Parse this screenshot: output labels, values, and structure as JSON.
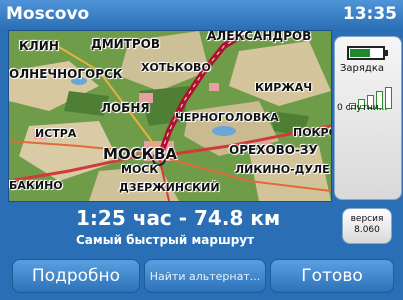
{
  "header": {
    "title": "Moscovo",
    "time": "13:35"
  },
  "map": {
    "cities": {
      "klin": "КЛИН",
      "dmitrov": "ДМИТРОВ",
      "aleksandrov": "АЛЕКСАНДРОВ",
      "hotkovo": "ХОТЬКОВО",
      "solnechnogorsk": "ОЛНЕЧНОГОРСК",
      "kirzhach": "КИРЖАЧ",
      "lobnya": "ЛОБНЯ",
      "chernogolovka": "ЧЕРНОГОЛОВКА",
      "istra": "ИСТРА",
      "pokrov": "ПОКРО",
      "moskva": "МОСКВА",
      "orekhovo": "ОРЕХОВО-ЗУ",
      "moskva2": "МОСК",
      "likino": "ЛИКИНО-ДУЛЕ",
      "bakino": "БАКИНО",
      "dzerzhinsky": "ДЗЕРЖИНСКИЙ"
    }
  },
  "sidebar": {
    "charge_label": "Зарядка",
    "satellites_label": "0 спутни..."
  },
  "version": {
    "line1": "версия",
    "line2": "8.060"
  },
  "route": {
    "summary": "1:25 час - 74.8 км",
    "type": "Самый быстрый маршрут"
  },
  "buttons": {
    "details": "Подробно",
    "alternative": "Найти альтернат...",
    "done": "Готово"
  }
}
